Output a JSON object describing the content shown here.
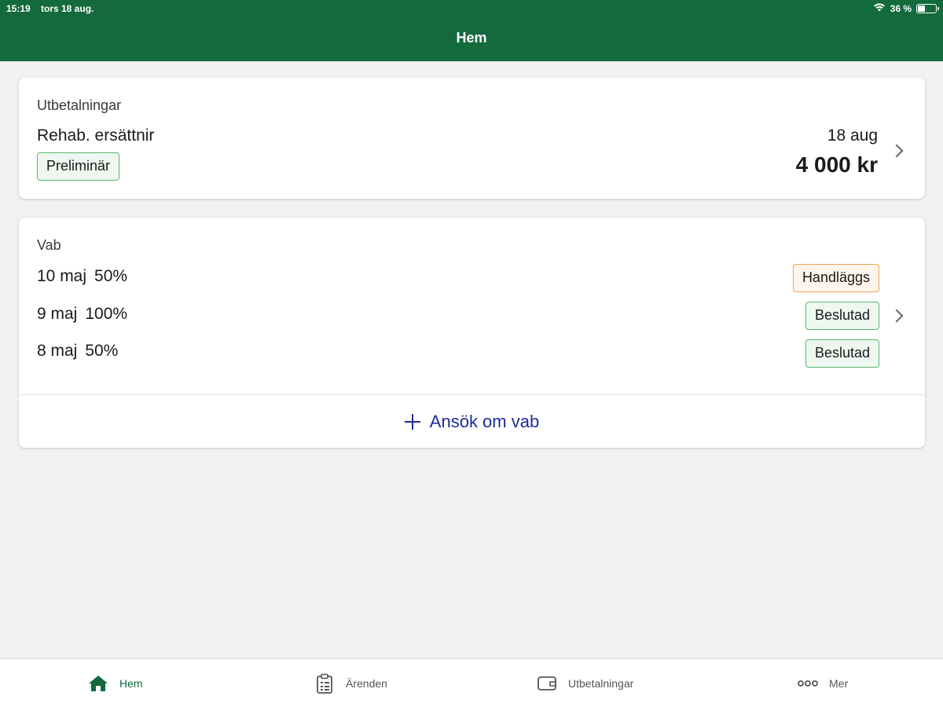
{
  "status_bar": {
    "time": "15:19",
    "date": "tors 18 aug.",
    "battery": "36 %"
  },
  "header": {
    "title": "Hem"
  },
  "payments_card": {
    "heading": "Utbetalningar",
    "title": "Rehab. ersättnir",
    "badge": "Preliminär",
    "date": "18 aug",
    "amount": "4 000 kr"
  },
  "vab_card": {
    "heading": "Vab",
    "rows": [
      {
        "date": "10 maj",
        "percent": "50%",
        "status": "Handläggs"
      },
      {
        "date": "9 maj",
        "percent": "100%",
        "status": "Beslutad"
      },
      {
        "date": "8 maj",
        "percent": "50%",
        "status": "Beslutad"
      }
    ],
    "apply_label": "Ansök om vab"
  },
  "bottom_nav": {
    "items": [
      {
        "label": "Hem",
        "icon": "home-icon",
        "active": true
      },
      {
        "label": "Ärenden",
        "icon": "clipboard-icon",
        "active": false
      },
      {
        "label": "Utbetalningar",
        "icon": "wallet-icon",
        "active": false
      },
      {
        "label": "Mer",
        "icon": "more-dots-icon",
        "active": false
      }
    ]
  },
  "colors": {
    "brand_green": "#136a3d",
    "link_blue": "#1e2a9c",
    "badge_green_border": "#56b46f",
    "badge_orange_border": "#f0a05a"
  }
}
